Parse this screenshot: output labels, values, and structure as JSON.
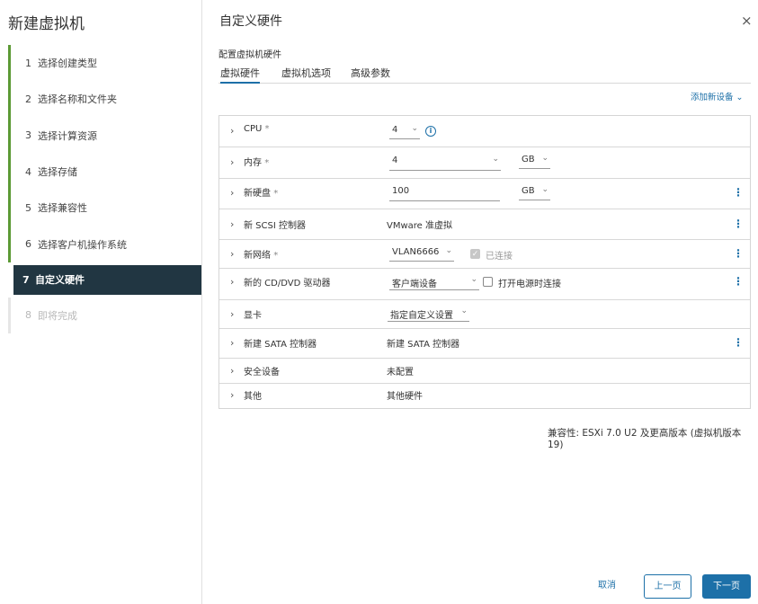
{
  "wizard": {
    "title": "新建虚拟机",
    "steps": [
      {
        "num": "1",
        "label": "选择创建类型"
      },
      {
        "num": "2",
        "label": "选择名称和文件夹"
      },
      {
        "num": "3",
        "label": "选择计算资源"
      },
      {
        "num": "4",
        "label": "选择存储"
      },
      {
        "num": "5",
        "label": "选择兼容性"
      },
      {
        "num": "6",
        "label": "选择客户机操作系统"
      },
      {
        "num": "7",
        "label": "自定义硬件"
      },
      {
        "num": "8",
        "label": "即将完成"
      }
    ],
    "active_step": 7
  },
  "page": {
    "title": "自定义硬件",
    "close_glyph": "×",
    "section_label": "配置虚拟机硬件",
    "tabs": [
      "虚拟硬件",
      "虚拟机选项",
      "高级参数"
    ],
    "add_device": "添加新设备 ⌄"
  },
  "hardware": {
    "cpu": {
      "label": "CPU",
      "required": "*",
      "value": "4"
    },
    "memory": {
      "label": "内存",
      "required": "*",
      "value": "4",
      "unit": "GB"
    },
    "disk": {
      "label": "新硬盘",
      "required": "*",
      "value": "100",
      "unit": "GB"
    },
    "scsi": {
      "label": "新 SCSI 控制器",
      "value": "VMware 准虚拟"
    },
    "network": {
      "label": "新网络",
      "required": "*",
      "value": "VLAN6666",
      "connected_label": "已连接"
    },
    "cdrom": {
      "label": "新的 CD/DVD 驱动器",
      "value": "客户端设备",
      "power_on_label": "打开电源时连接"
    },
    "video": {
      "label": "显卡",
      "value": "指定自定义设置"
    },
    "sata": {
      "label": "新建 SATA 控制器",
      "value": "新建 SATA 控制器"
    },
    "security": {
      "label": "安全设备",
      "value": "未配置"
    },
    "other": {
      "label": "其他",
      "value": "其他硬件"
    }
  },
  "compat": {
    "label": "兼容性:",
    "value": " ESXi 7.0 U2 及更高版本 (虚拟机版本 19)"
  },
  "footer": {
    "cancel": "取消",
    "prev": "上一页",
    "next": "下一页"
  },
  "icons": {
    "chevron": "›",
    "caret": "⌄",
    "kebab": "⋮",
    "info": "i",
    "check": "✓"
  },
  "colors": {
    "accent": "#1d70a8",
    "active_step_bg": "#213642",
    "step_bar": "#5c9a35"
  }
}
